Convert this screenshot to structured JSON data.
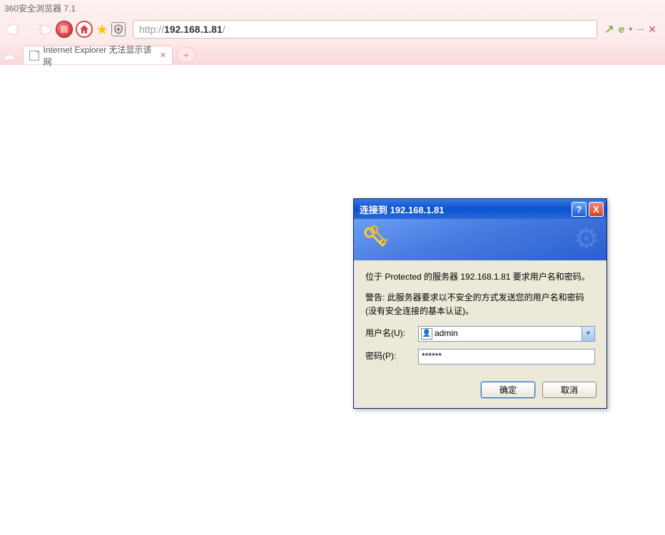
{
  "browser": {
    "title": "360安全浏览器 7.1",
    "url": {
      "protocol": "http://",
      "host": "192.168.1.81",
      "path": "/"
    },
    "tab": {
      "label": "Internet Explorer 无法显示该网"
    },
    "icons": {
      "shield": "shield-icon",
      "share": "share-icon",
      "engine": "e-icon",
      "close": "close-icon",
      "newtab": "+"
    }
  },
  "dialog": {
    "title": "连接到 192.168.1.81",
    "message1": "位于 Protected 的服务器 192.168.1.81 要求用户名和密码。",
    "message2": "警告: 此服务器要求以不安全的方式发送您的用户名和密码(没有安全连接的基本认证)。",
    "username_label": "用户名(U):",
    "password_label": "密码(P):",
    "username_value": "admin",
    "password_value": "******",
    "ok_label": "确定",
    "cancel_label": "取消"
  }
}
